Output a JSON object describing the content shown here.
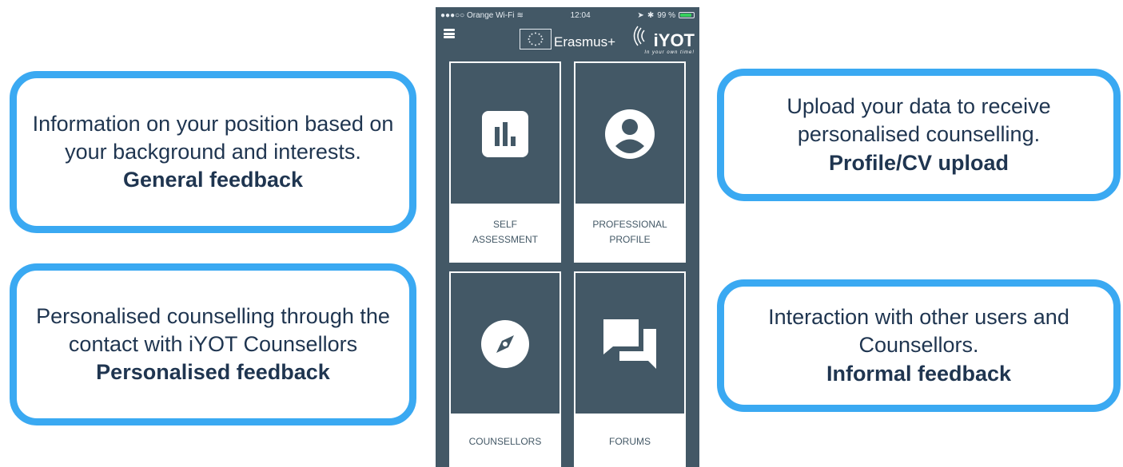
{
  "callouts": {
    "general": {
      "text": "Information on your position based on your background and interests.",
      "strong": "General feedback"
    },
    "personal": {
      "text": "Personalised counselling through the contact with iYOT Counsellors",
      "strong": "Personalised feedback"
    },
    "upload": {
      "text": "Upload your data to receive personalised counselling.",
      "strong": "Profile/CV upload"
    },
    "informal": {
      "text": "Interaction with other users and Counsellors.",
      "strong": "Informal feedback"
    }
  },
  "phone": {
    "status": {
      "carrier": "●●●○○ Orange Wi-Fi",
      "time": "12:04",
      "battery": "99 %"
    },
    "header": {
      "program": "Erasmus+",
      "brand": "iYOT",
      "tagline": "In your own time!"
    },
    "tiles": {
      "self": {
        "label": "SELF\nASSESSMENT",
        "icon": "bar-chart-icon"
      },
      "profile": {
        "label": "PROFESSIONAL\nPROFILE",
        "icon": "user-profile-icon"
      },
      "counsellors": {
        "label": "COUNSELLORS",
        "icon": "compass-icon"
      },
      "forums": {
        "label": "FORUMS",
        "icon": "chat-bubbles-icon"
      }
    }
  },
  "colors": {
    "callout_border": "#3aa9f2",
    "text_dark": "#1f3550",
    "phone_bg": "#435866"
  }
}
